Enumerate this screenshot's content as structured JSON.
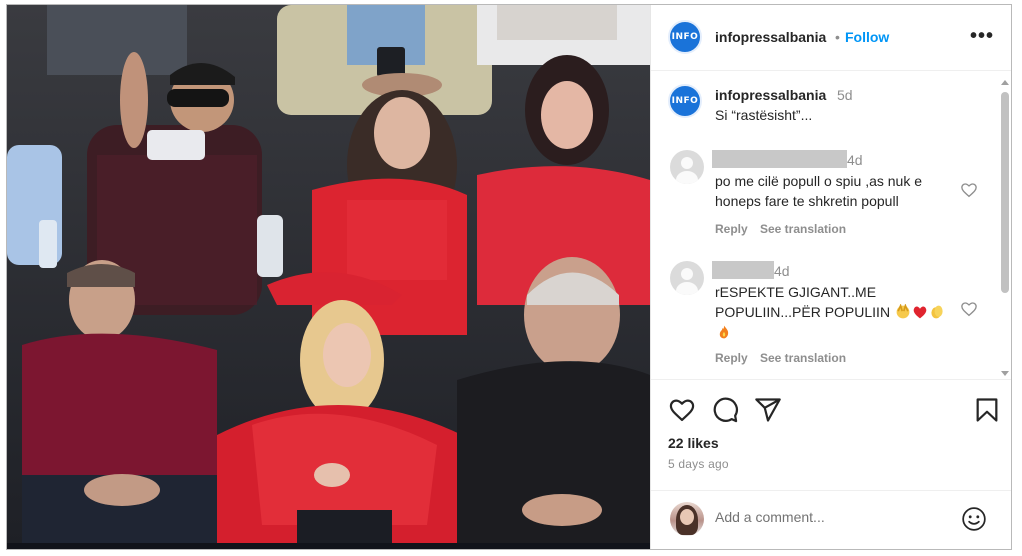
{
  "post": {
    "username": "infopressalbania",
    "follow_separator": "•",
    "follow_label": "Follow",
    "more_label": "•••",
    "avatar_text": "INFO"
  },
  "caption": {
    "username": "infopressalbania",
    "time": "5d",
    "text": "Si “rastësisht”..."
  },
  "comments": [
    {
      "time": "4d",
      "text": "po me cilë popull o spiu ,as nuk e honeps fare te shkretin popull",
      "reply_label": "Reply",
      "translation_label": "See translation"
    },
    {
      "time": "4d",
      "text": "rESPEKTE GJIGANT..ME POPULIIN...PËR POPULIIN",
      "emojis": [
        "raising-hands-emoji",
        "red-heart-emoji",
        "clapping-hands-emoji",
        "fire-emoji"
      ],
      "reply_label": "Reply",
      "translation_label": "See translation"
    }
  ],
  "actions": {
    "icons": [
      "heart-icon",
      "comment-icon",
      "share-icon",
      "bookmark-icon"
    ],
    "likes": "22 likes",
    "ago": "5 days ago"
  },
  "add_comment": {
    "placeholder": "Add a comment..."
  },
  "colors": {
    "link_blue": "#0095f6",
    "secondary_text": "#8e8e8e",
    "primary_text": "#262626",
    "albania_red": "#d8242c"
  }
}
